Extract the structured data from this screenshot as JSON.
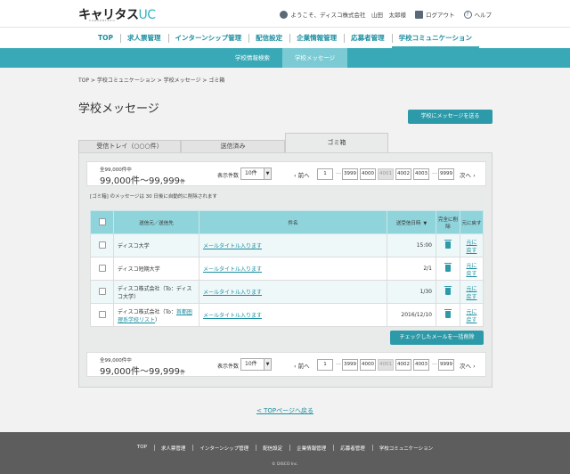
{
  "header": {
    "logo_main": "キャリタス",
    "logo_uc": "UC",
    "logo_sub": "CAREERTASU",
    "welcome": "ようこそ、ディスコ株式会社　山田　太郎様",
    "logout": "ログアウト",
    "help": "ヘルプ"
  },
  "gnav": [
    "TOP",
    "求人票管理",
    "インターンシップ管理",
    "配信設定",
    "企業情報管理",
    "応募者管理",
    "学校コミュニケーション"
  ],
  "subnav": [
    "学校情報検索",
    "学校メッセージ"
  ],
  "breadcrumb": "TOP > 学校コミュニケーション > 学校メッセージ > ゴミ箱",
  "page_title": "学校メッセージ",
  "send_button": "学校にメッセージを送る",
  "tabs": [
    "受信トレイ（○○○件）",
    "送信済み",
    "ゴミ箱"
  ],
  "pager": {
    "count": "全99,000件中",
    "range": "99,000件～99,999",
    "range_unit": "件",
    "per_page_label": "表示件数",
    "per_page_value": "10件",
    "prev": "前へ",
    "next": "次へ",
    "pages": [
      "1",
      "3999",
      "4000",
      "4001",
      "4002",
      "4003",
      "9999"
    ],
    "ellipsis": "…"
  },
  "notice": "[ゴミ箱] のメッセージは 30 日後に自動的に削除されます",
  "table": {
    "headers": [
      "送信元／送信先",
      "件名",
      "送受信日時",
      "完全に削除",
      "元に戻す"
    ],
    "rows": [
      {
        "from": "ディスコ大学",
        "subject": "メールタイトル入ります",
        "date": "15:00",
        "restore": "元に戻す"
      },
      {
        "from": "ディスコ短期大学",
        "subject": "メールタイトル入ります",
        "date": "2/1",
        "restore": "元に戻す"
      },
      {
        "from": "ディスコ株式会社（To：ディスコ大学）",
        "subject": "メールタイトル入ります",
        "date": "1/30",
        "restore": "元に戻す"
      },
      {
        "from_prefix": "ディスコ株式会社（To：",
        "from_link": "首都圏理系学校リスト",
        "from_suffix": "）",
        "subject": "メールタイトル入ります",
        "date": "2016/12/10",
        "restore": "元に戻す"
      }
    ]
  },
  "bulk_delete": "チェックしたメールを一括削除",
  "top_link": "< TOPページへ戻る",
  "footer": {
    "nav": [
      "TOP",
      "求人票管理",
      "インターンシップ管理",
      "配信設定",
      "企業情報管理",
      "応募者管理",
      "学校コミュニケーション"
    ],
    "copyright": "© DISCO Inc."
  }
}
